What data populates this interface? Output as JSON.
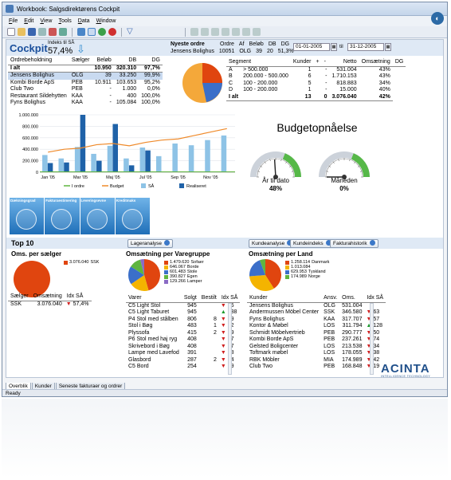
{
  "window": {
    "title": "Workbook: Salgsdirektørens Cockpit"
  },
  "menu": [
    {
      "pre": "",
      "u": "F",
      "post": "ile"
    },
    {
      "pre": "",
      "u": "E",
      "post": "dit"
    },
    {
      "pre": "",
      "u": "V",
      "post": "iew"
    },
    {
      "pre": "",
      "u": "T",
      "post": "ools"
    },
    {
      "pre": "",
      "u": "D",
      "post": "ata"
    },
    {
      "pre": "",
      "u": "W",
      "post": "indow"
    }
  ],
  "header": {
    "title": "Cockpit",
    "index_label": "Indeks til SÅ",
    "index_value": "57,4%",
    "newest_order_label": "Nyeste ordre",
    "newest_cols": [
      "Ordre",
      "Af",
      "Beløb",
      "DB",
      "DG"
    ],
    "newest_values": [
      "Jensens Bolighus",
      "10051",
      "OLG",
      "39",
      "20",
      "51,3%"
    ],
    "date_from": "01-01-2005",
    "date_to_label": "til",
    "date_to": "31-12-2005"
  },
  "orders": {
    "title": "Ordrebeholdning",
    "cols": [
      "Sælger",
      "Beløb",
      "DB",
      "DG"
    ],
    "total": [
      "I alt",
      "",
      "10.950",
      "320.310",
      "97,7%"
    ],
    "rows": [
      [
        "Jensens Bolighus",
        "OLG",
        "39",
        "33.250",
        "99,9%"
      ],
      [
        "Kombi Borde ApS",
        "PEB",
        "10.911",
        "103.653",
        "95,2%"
      ],
      [
        "Club Two",
        "PEB",
        "-",
        "1.000",
        "0,0%"
      ],
      [
        "Restaurant Sildehytten",
        "KAA",
        "-",
        "400",
        "100,0%"
      ],
      [
        "Fyns Bolighus",
        "KAA",
        "-",
        "105.084",
        "100,0%"
      ]
    ]
  },
  "segments": {
    "cols": [
      "Segment",
      "Kunder",
      "+",
      "-",
      "Netto",
      "Omsætning",
      "DG"
    ],
    "rows": [
      [
        "A",
        "> 500.000",
        "1",
        "",
        "-",
        "531.004",
        "43%"
      ],
      [
        "B",
        "200.000 - 500.000",
        "6",
        "",
        "-",
        "1.710.153",
        "43%"
      ],
      [
        "C",
        "100 - 200.000",
        "5",
        "",
        "-",
        "818.883",
        "34%"
      ],
      [
        "D",
        "100 - 200.000",
        "1",
        "",
        "-",
        "15.000",
        "40%"
      ]
    ],
    "total": [
      "I alt",
      "",
      "13",
      "",
      "0",
      "3.076.040",
      "42%"
    ]
  },
  "budget": {
    "title": "Budgetopnåelse",
    "gauge1_label": "År til dato",
    "gauge1_value": "48%",
    "gauge2_label": "Måneden",
    "gauge2_value": "0%"
  },
  "combo_chart": {
    "yticks": [
      "1.000.000",
      "800.000",
      "600.000",
      "400.000",
      "200.000",
      "0"
    ],
    "xticks": [
      "Jan '05",
      "Mar '05",
      "Maj '05",
      "Jul '05",
      "Sep '05",
      "Nov '05"
    ],
    "legend": [
      "I ordre",
      "Budget",
      "SÅ",
      "Realiseret"
    ]
  },
  "mini_panels": [
    "Dækningsgrad",
    "Fakturaestimering",
    "Leveringsevne",
    "Kreditmaks"
  ],
  "top10": {
    "title": "Top 10",
    "buttons": [
      "Lageranalyse",
      "Kundeanalyse",
      "Kundeindeks",
      "Fakturahistorik"
    ]
  },
  "sellers": {
    "title": "Oms. per sælger",
    "legend": [
      {
        "value": "3.076.040",
        "name": "SSK",
        "color": "#e0450f"
      }
    ],
    "cols": [
      "Sælger",
      "Omsætning",
      "Idx SÅ"
    ],
    "rows": [
      {
        "c": [
          "SSK",
          "3.076.040",
          "57,4%"
        ],
        "t": "down"
      }
    ]
  },
  "goods": {
    "title": "Omsætning per Varegruppe",
    "legend": [
      {
        "value": "1.479.620",
        "name": "Sofaer",
        "color": "#e0450f"
      },
      {
        "value": "646.067",
        "name": "Borde",
        "color": "#f4b400"
      },
      {
        "value": "601.483",
        "name": "Stole",
        "color": "#3b6fc9"
      },
      {
        "value": "390.827",
        "name": "Egen",
        "color": "#5fb53f"
      },
      {
        "value": "129.266",
        "name": "Lamper",
        "color": "#8a6bc4"
      }
    ],
    "cols": [
      "Varer",
      "Solgt",
      "Bestilt",
      "Idx SÅ"
    ],
    "rows": [
      {
        "c": [
          "C5 Light Stol",
          "945",
          "",
          "75"
        ],
        "t": "down"
      },
      {
        "c": [
          "C5 Light Taburet",
          "945",
          "",
          "138"
        ],
        "t": "up"
      },
      {
        "c": [
          "P4 Stol med stålben",
          "806",
          "8",
          "79"
        ],
        "t": "down"
      },
      {
        "c": [
          "Stol i Bøg",
          "483",
          "1",
          "92"
        ],
        "t": "down"
      },
      {
        "c": [
          "Plyssofa",
          "415",
          "2",
          "39"
        ],
        "t": "down"
      },
      {
        "c": [
          "P6 Stol med haj ryg",
          "408",
          "",
          "67"
        ],
        "t": "down"
      },
      {
        "c": [
          "Skrivebord i Bøg",
          "408",
          "",
          "67"
        ],
        "t": "down"
      },
      {
        "c": [
          "Lampe med Lavefod",
          "391",
          "",
          "28"
        ],
        "t": "down"
      },
      {
        "c": [
          "Glasbord",
          "287",
          "2",
          "64"
        ],
        "t": "down"
      },
      {
        "c": [
          "C5 Bord",
          "254",
          "",
          "59"
        ],
        "t": "down"
      }
    ]
  },
  "countries": {
    "title": "Omsætning per Land",
    "legend": [
      {
        "value": "1.258.114",
        "name": "Danmark",
        "color": "#e0450f"
      },
      {
        "value": "1.013.084",
        "name": "",
        "color": "#f4b400"
      },
      {
        "value": "629.953",
        "name": "Tyskland",
        "color": "#3b6fc9"
      },
      {
        "value": "174.989",
        "name": "Norge",
        "color": "#5fb53f"
      }
    ],
    "cols": [
      "Kunder",
      "Ansv.",
      "Oms.",
      "Idx SÅ"
    ],
    "rows": [
      {
        "c": [
          "Jensens Bolighus",
          "OLG",
          "531.004",
          ""
        ],
        "t": ""
      },
      {
        "c": [
          "Andermussen Möbel Center",
          "SSK",
          "346.580",
          "63"
        ],
        "t": "down"
      },
      {
        "c": [
          "Fyns Bolighus",
          "KAA",
          "317.707",
          "57"
        ],
        "t": "down"
      },
      {
        "c": [
          "Kontor & Møbel",
          "LOS",
          "311.794",
          "128"
        ],
        "t": "up"
      },
      {
        "c": [
          "Schmidt Möbelvertrieb",
          "PEB",
          "290.777",
          "50"
        ],
        "t": "down"
      },
      {
        "c": [
          "Kombi Borde ApS",
          "PEB",
          "237.261",
          "74"
        ],
        "t": "down"
      },
      {
        "c": [
          "Gelsted Boligcenter",
          "LOS",
          "213.538",
          "34"
        ],
        "t": "down"
      },
      {
        "c": [
          "Toftmark møbel",
          "LOS",
          "178.055",
          "38"
        ],
        "t": "down"
      },
      {
        "c": [
          "RBK Möbler",
          "MIA",
          "174.989",
          "42"
        ],
        "t": "down"
      },
      {
        "c": [
          "Club Two",
          "PEB",
          "168.848",
          "19"
        ],
        "t": "down"
      }
    ]
  },
  "brand": {
    "name": "ACINTA",
    "tagline": "INTELLIGENCE TECHNOLOGY"
  },
  "tabs": [
    "Overblik",
    "Kunder",
    "Seneste fakturaer og ordrer"
  ],
  "status": "Ready",
  "chart_data": {
    "type": "bar",
    "categories": [
      "Jan '05",
      "Feb '05",
      "Mar '05",
      "Apr '05",
      "Maj '05",
      "Jun '05",
      "Jul '05",
      "Aug '05",
      "Sep '05",
      "Okt '05",
      "Nov '05",
      "Dec '05"
    ],
    "series": [
      {
        "name": "SÅ",
        "values": [
          300000,
          240000,
          440000,
          320000,
          460000,
          240000,
          430000,
          280000,
          500000,
          470000,
          560000,
          640000
        ]
      },
      {
        "name": "Realiseret",
        "values": [
          160000,
          170000,
          1000000,
          200000,
          840000,
          120000,
          380000,
          0,
          0,
          0,
          0,
          0
        ]
      },
      {
        "name": "Budget",
        "values": [
          350000,
          400000,
          420000,
          480000,
          500000,
          460000,
          520000,
          560000,
          580000,
          640000,
          700000,
          760000
        ]
      },
      {
        "name": "I ordre",
        "values": [
          0,
          0,
          0,
          0,
          0,
          0,
          0,
          0,
          0,
          0,
          0,
          10950
        ]
      }
    ],
    "ylim": [
      0,
      1000000
    ]
  }
}
